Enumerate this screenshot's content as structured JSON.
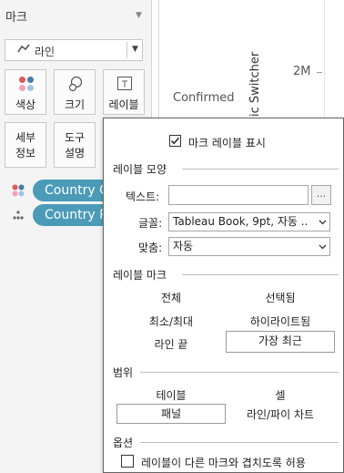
{
  "marks_card": {
    "title": "마크",
    "mark_type": "라인",
    "buttons": {
      "color": "색상",
      "size": "크기",
      "label": "레이블",
      "detail": "세부\n정보",
      "tooltip": "도구\n설명"
    },
    "pills": [
      "Country Other",
      "Country Pl"
    ]
  },
  "chart": {
    "series_label": "Confirmed",
    "axis_title": "ic Switcher",
    "tick_label": "2M"
  },
  "label_popup": {
    "show_labels": "마크 레이블 표시",
    "section_appearance": "레이블 모양",
    "text_label": "텍스트:",
    "text_value": "",
    "text_button": "...",
    "font_label": "글꼴:",
    "font_value": "Tableau Book, 9pt, 자동 ..",
    "align_label": "맞춤:",
    "align_value": "자동",
    "section_marks": "레이블 마크",
    "mark_options": [
      "전체",
      "선택됨",
      "최소/최대",
      "하이라이트됨",
      "라인 끝",
      "가장 최근"
    ],
    "selected_mark_option": "가장 최근",
    "section_scope": "범위",
    "scope_options": [
      "테이블",
      "셀",
      "패널",
      "라인/파이 차트"
    ],
    "selected_scope_option": "패널",
    "section_options": "옵션",
    "allow_overlap": "레이블이 다른 마크와 겹치도록 허용"
  },
  "colors": {
    "pill": "#4b9bb8",
    "dot_red": "#e15759",
    "dot_blue": "#4e79a7",
    "dot_pink": "#f2a0b8",
    "dot_lightblue": "#a0c4e0"
  }
}
